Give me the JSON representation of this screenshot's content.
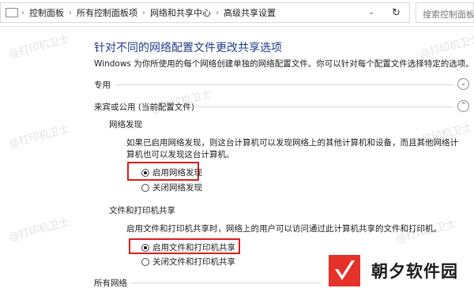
{
  "address_bar": {
    "crumbs": [
      "控制面板",
      "所有控制面板项",
      "网络和共享中心",
      "高级共享设置"
    ],
    "search_placeholder": "搜索控制面板"
  },
  "page": {
    "title": "针对不同的网络配置文件更改共享选项",
    "description": "Windows 为你所使用的每个网络创建单独的网络配置文件。你可以针对每个配置文件选择特定的选项。"
  },
  "profiles": {
    "private": "专用",
    "guest_public": "来宾或公用 (当前配置文件)",
    "all_networks": "所有网络"
  },
  "network_discovery": {
    "heading": "网络发现",
    "text": "如果已启用网络发现，则这台计算机可以发现网络上的其他计算机和设备，而且其他网络计算机也可以发现这台计算机。",
    "on_label": "启用网络发现",
    "off_label": "关闭网络发现",
    "selected": "on"
  },
  "file_printer_sharing": {
    "heading": "文件和打印机共享",
    "text": "启用文件和打印机共享时，网络上的用户可以访问通过此计算机共享的文件和打印机。",
    "on_label": "启用文件和打印机共享",
    "off_label": "关闭文件和打印机共享",
    "selected": "on"
  },
  "watermark": {
    "text": "@打印机卫士"
  },
  "brand": {
    "name": "朝夕软件园",
    "accent": "#e4322b"
  },
  "highlight_color": "#d91e18"
}
